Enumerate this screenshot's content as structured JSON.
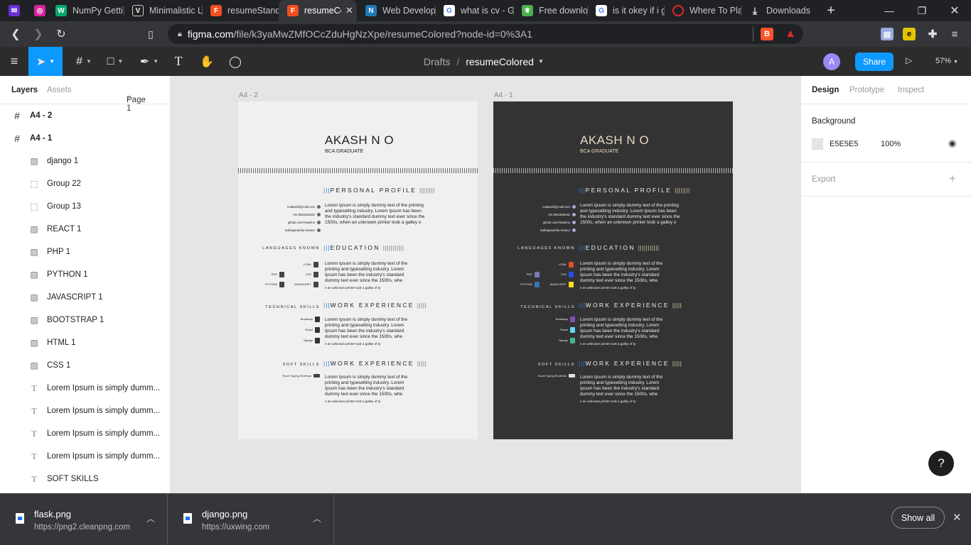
{
  "browser": {
    "tabs": [
      {
        "title": "",
        "icon": "mail-icon",
        "color": "#6b2fd6"
      },
      {
        "title": "",
        "icon": "instagram-icon",
        "color": "#d6249f"
      },
      {
        "title": "NumPy Getti",
        "icon": "w3-icon",
        "color": "#04aa6d"
      },
      {
        "title": "Minimalistic L",
        "icon": "v-icon",
        "color": "#222222"
      },
      {
        "title": "resumeStand",
        "icon": "figma-icon",
        "color": "#f24e1e"
      },
      {
        "title": "resumeCo",
        "icon": "figma-icon",
        "color": "#f24e1e",
        "active": true
      },
      {
        "title": "Web Develop",
        "icon": "n-icon",
        "color": "#1f7ab8"
      },
      {
        "title": "what is cv - G",
        "icon": "google-icon",
        "color": "#ffffff"
      },
      {
        "title": "Free downloa",
        "icon": "leaf-icon",
        "color": "#4caf50"
      },
      {
        "title": "is it okey if i g",
        "icon": "google-icon",
        "color": "#ffffff"
      },
      {
        "title": "Where To Pla",
        "icon": "opera-icon",
        "color": "#e0292d"
      },
      {
        "title": "Downloads",
        "icon": "download-icon",
        "color": "#ffffff"
      }
    ],
    "url_host": "figma.com",
    "url_path": "/file/k3yaMwZMfOCcZduHgNzXpe/resumeColored?node-id=0%3A1"
  },
  "figma": {
    "breadcrumb_folder": "Drafts",
    "breadcrumb_sep": "/",
    "file_name": "resumeColored",
    "avatar_initial": "A",
    "share_label": "Share",
    "zoom": "57%",
    "left_tabs": [
      "Layers",
      "Assets"
    ],
    "page_label": "Page 1",
    "layers": [
      {
        "name": "A4 - 2",
        "icon": "frame-icon",
        "indent": 0
      },
      {
        "name": "A4 - 1",
        "icon": "frame-icon",
        "indent": 0
      },
      {
        "name": "django 1",
        "icon": "image-icon",
        "indent": 1
      },
      {
        "name": "Group 22",
        "icon": "group-icon",
        "indent": 1
      },
      {
        "name": "Group 13",
        "icon": "group-icon",
        "indent": 1
      },
      {
        "name": "REACT 1",
        "icon": "image-icon",
        "indent": 1
      },
      {
        "name": "PHP 1",
        "icon": "image-icon",
        "indent": 1
      },
      {
        "name": "PYTHON 1",
        "icon": "image-icon",
        "indent": 1
      },
      {
        "name": "JAVASCRIPT 1",
        "icon": "image-icon",
        "indent": 1
      },
      {
        "name": "BOOTSTRAP 1",
        "icon": "image-icon",
        "indent": 1
      },
      {
        "name": "HTML 1",
        "icon": "image-icon",
        "indent": 1
      },
      {
        "name": "CSS 1",
        "icon": "image-icon",
        "indent": 1
      },
      {
        "name": "Lorem Ipsum is simply dumm...",
        "icon": "text-icon",
        "indent": 1
      },
      {
        "name": "Lorem Ipsum is simply dumm...",
        "icon": "text-icon",
        "indent": 1
      },
      {
        "name": "Lorem Ipsum is simply dumm...",
        "icon": "text-icon",
        "indent": 1
      },
      {
        "name": "Lorem Ipsum is simply dumm...",
        "icon": "text-icon",
        "indent": 1
      },
      {
        "name": "SOFT SKILLS",
        "icon": "text-icon",
        "indent": 1
      }
    ],
    "right_tabs": [
      "Design",
      "Prototype",
      "Inspect"
    ],
    "background_label": "Background",
    "background_hex": "E5E5E5",
    "background_opacity": "100%",
    "export_label": "Export",
    "help_label": "?"
  },
  "frames": {
    "light_label": "A4 - 2",
    "dark_label": "A4 - 1",
    "name": "AKASH N O",
    "subtitle": "BCA GRADUATE",
    "sec_personal": "PERSONAL PROFILE",
    "sec_education": "EDUCATION",
    "sec_work": "WORK EXPERIENCE",
    "side_languages": "LANGUAGES KNOWN",
    "side_technical": "TECHNICAL SKILLS",
    "side_soft": "SOFT SKILLS",
    "contacts": [
      "noakash@ymail.com",
      "+91 9061936162",
      "github.com/Akashno",
      "Kathaparamba Kannur"
    ],
    "profile_text": "Lorem Ipsum is simply dummy text of the printing and typesetting industry. Lorem Ipsum has been the industry's standard dummy text ever since the 1500s, when an unknown printer took a galley o",
    "block_text": "Lorem Ipsum is simply dummy text of the printing and typesetting industry. Lorem Ipsum has been the industry's standard dummy text ever since the 1500s, whe",
    "block_tail": "n an unknown printer took a galley of ty",
    "languages": [
      "HTML",
      "CSS",
      "PHP",
      "JAVASCRIPT",
      "PYTHON"
    ],
    "tech": [
      "Bootstrap",
      "React",
      "Django"
    ],
    "soft": "Touch Typing Shorthan"
  },
  "downloads": {
    "items": [
      {
        "name": "flask.png",
        "source": "https://png2.cleanpng.com"
      },
      {
        "name": "django.png",
        "source": "https://uxwing.com"
      }
    ],
    "show_all": "Show all"
  },
  "colors": {
    "accent": "#0d99ff",
    "resume_blue": "#2a7fd9",
    "dark_frame": "#333333",
    "canvas": "#e5e5e5"
  }
}
